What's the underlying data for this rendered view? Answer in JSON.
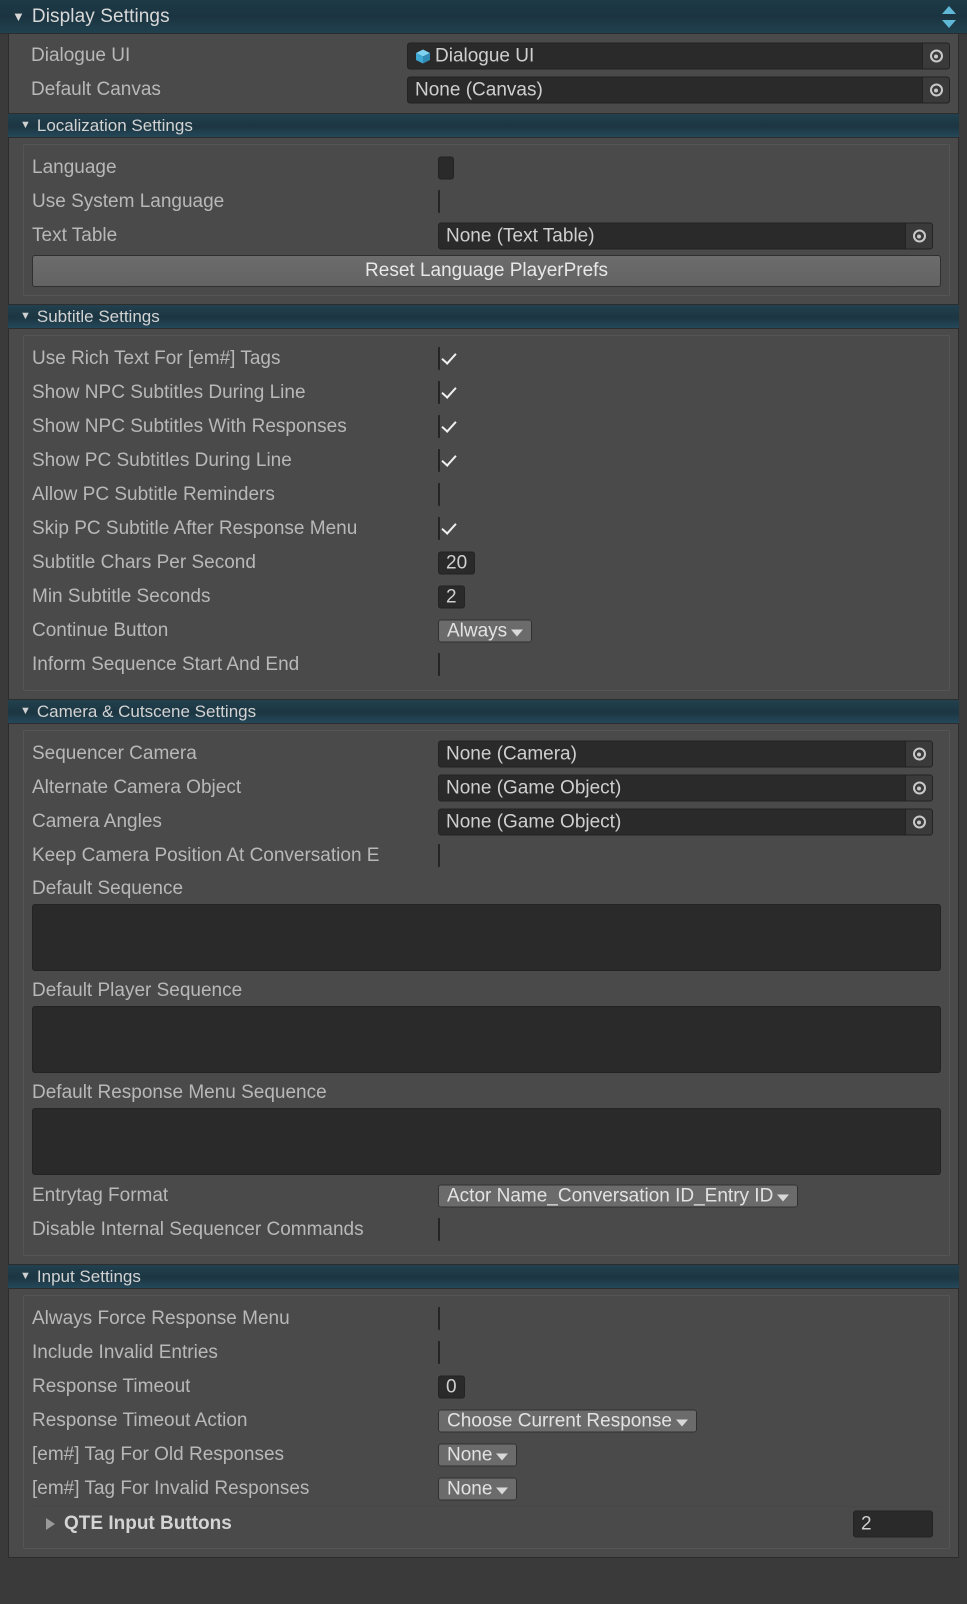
{
  "header": {
    "title": "Display Settings",
    "foldout_arrow": "▼",
    "sort_icon": "up-down-arrows-icon",
    "accent_color": "#5fb8d8"
  },
  "top_fields": [
    {
      "label": "Dialogue UI",
      "type": "object",
      "value": "Dialogue UI",
      "icon": "prefab-cube-icon",
      "has_icon": true,
      "picker": "object-picker-icon"
    },
    {
      "label": "Default Canvas",
      "type": "object",
      "value": "None (Canvas)",
      "has_icon": false,
      "picker": "object-picker-icon"
    }
  ],
  "sections": [
    {
      "id": "localization",
      "title": "Localization Settings",
      "arrow": "▼",
      "rows": [
        {
          "label": "Language",
          "type": "text",
          "value": ""
        },
        {
          "label": "Use System Language",
          "type": "checkbox",
          "checked": false
        },
        {
          "label": "Text Table",
          "type": "object",
          "value": "None (Text Table)"
        }
      ],
      "button": {
        "label": "Reset Language PlayerPrefs"
      }
    },
    {
      "id": "subtitle",
      "title": "Subtitle Settings",
      "arrow": "▼",
      "rows": [
        {
          "label": "Use Rich Text For [em#] Tags",
          "type": "checkbox",
          "checked": true
        },
        {
          "label": "Show NPC Subtitles During Line",
          "type": "checkbox",
          "checked": true
        },
        {
          "label": "Show NPC Subtitles With Responses",
          "type": "checkbox",
          "checked": true
        },
        {
          "label": "Show PC Subtitles During Line",
          "type": "checkbox",
          "checked": true
        },
        {
          "label": "Allow PC Subtitle Reminders",
          "type": "checkbox",
          "checked": false
        },
        {
          "label": "Skip PC Subtitle After Response Menu",
          "type": "checkbox",
          "checked": true
        },
        {
          "label": "Subtitle Chars Per Second",
          "type": "text",
          "value": "20"
        },
        {
          "label": "Min Subtitle Seconds",
          "type": "text",
          "value": "2"
        },
        {
          "label": "Continue Button",
          "type": "dropdown",
          "value": "Always"
        },
        {
          "label": "Inform Sequence Start And End",
          "type": "checkbox",
          "checked": false
        }
      ]
    },
    {
      "id": "camera",
      "title": "Camera & Cutscene Settings",
      "arrow": "▼",
      "rows": [
        {
          "label": "Sequencer Camera",
          "type": "object",
          "value": "None (Camera)"
        },
        {
          "label": "Alternate Camera Object",
          "type": "object",
          "value": "None (Game Object)"
        },
        {
          "label": "Camera Angles",
          "type": "object",
          "value": "None (Game Object)"
        },
        {
          "label": "Keep Camera Position At Conversation E",
          "type": "checkbox",
          "checked": false,
          "truncated": true
        },
        {
          "label": "Default Sequence",
          "type": "textarea",
          "value": ""
        },
        {
          "label": "Default Player Sequence",
          "type": "textarea",
          "value": ""
        },
        {
          "label": "Default Response Menu Sequence",
          "type": "textarea",
          "value": ""
        },
        {
          "label": "Entrytag Format",
          "type": "dropdown",
          "value": "Actor Name_Conversation ID_Entry ID"
        },
        {
          "label": "Disable Internal Sequencer Commands",
          "type": "checkbox",
          "checked": false
        }
      ]
    },
    {
      "id": "input",
      "title": "Input Settings",
      "arrow": "▼",
      "rows": [
        {
          "label": "Always Force Response Menu",
          "type": "checkbox",
          "checked": false
        },
        {
          "label": "Include Invalid Entries",
          "type": "checkbox",
          "checked": false
        },
        {
          "label": "Response Timeout",
          "type": "text",
          "value": "0"
        },
        {
          "label": "Response Timeout Action",
          "type": "dropdown",
          "value": "Choose Current Response"
        },
        {
          "label": "[em#] Tag For Old Responses",
          "type": "dropdown",
          "value": "None"
        },
        {
          "label": "[em#] Tag For Invalid Responses",
          "type": "dropdown",
          "value": "None"
        }
      ],
      "foldout": {
        "label": "QTE Input Buttons",
        "arrow": "▶",
        "count": "2"
      }
    }
  ]
}
